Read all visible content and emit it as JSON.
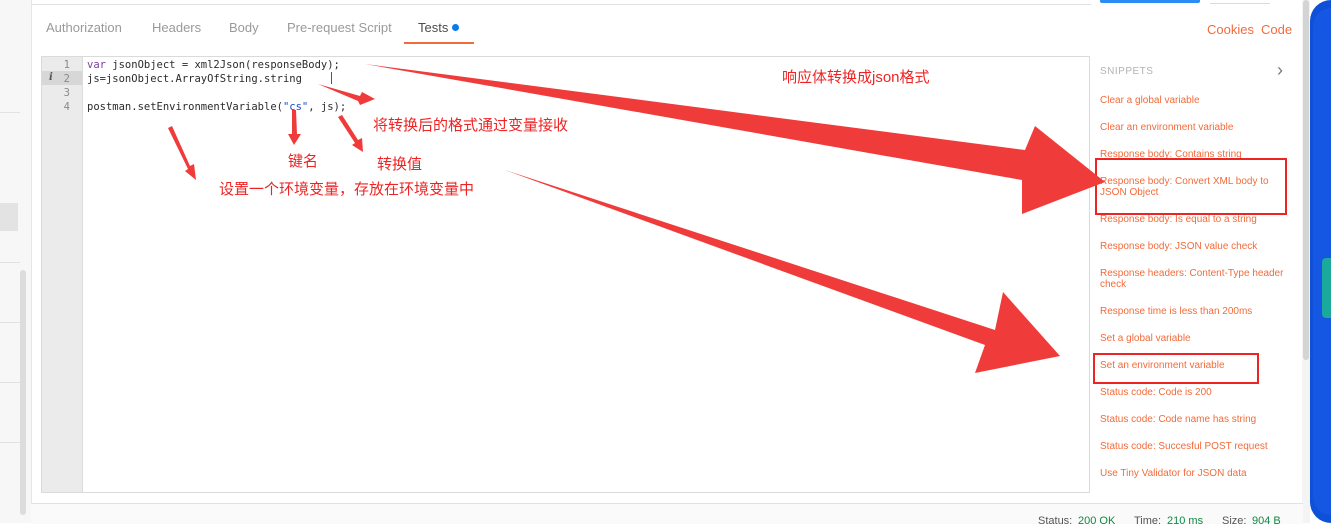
{
  "tabs": [
    {
      "label": "Authorization",
      "active": false
    },
    {
      "label": "Headers",
      "active": false
    },
    {
      "label": "Body",
      "active": false
    },
    {
      "label": "Pre-request Script",
      "active": false
    },
    {
      "label": "Tests",
      "active": true
    }
  ],
  "top_links": {
    "cookies": "Cookies",
    "code": "Code"
  },
  "editor": {
    "line_numbers": [
      "1",
      "2",
      "3",
      "4"
    ],
    "line1": {
      "kw": "var",
      "rest": " jsonObject = xml2Json(responseBody);"
    },
    "line2": "js=jsonObject.ArrayOfString.string",
    "line3": "",
    "line4": {
      "prefix": "postman.setEnvironmentVariable(",
      "string": "\"cs\"",
      "suffix": ", js);"
    },
    "info_marker": "i"
  },
  "snippets": {
    "title": "SNIPPETS",
    "items": [
      "Clear a global variable",
      "Clear an environment variable",
      "Response body: Contains string",
      "Response body: Convert XML body to JSON Object",
      "Response body: Is equal to a string",
      "Response body: JSON value check",
      "Response headers: Content-Type header check",
      "Response time is less than 200ms",
      "Set a global variable",
      "Set an environment variable",
      "Status code: Code is 200",
      "Status code: Code name has string",
      "Status code: Succesful POST request",
      "Use Tiny Validator for JSON data"
    ]
  },
  "annotations": {
    "response_to_json": "响应体转换成json格式",
    "receive_converted": "将转换后的格式通过变量接收",
    "key_name": "键名",
    "converted_value": "转换值",
    "set_env_var": "设置一个环境变量，存放在环境变量中"
  },
  "status_bar": {
    "status_label": "Status:",
    "status_value": "200 OK",
    "time_label": "Time:",
    "time_value": "210 ms",
    "size_label": "Size:",
    "size_value": "904 B"
  },
  "colors": {
    "accent": "#f26b3a",
    "annotation": "#ee2424",
    "tab_dot": "#097bed",
    "frame": "#0f50d8"
  },
  "icons": [
    "chevron-right-icon",
    "info-icon"
  ]
}
